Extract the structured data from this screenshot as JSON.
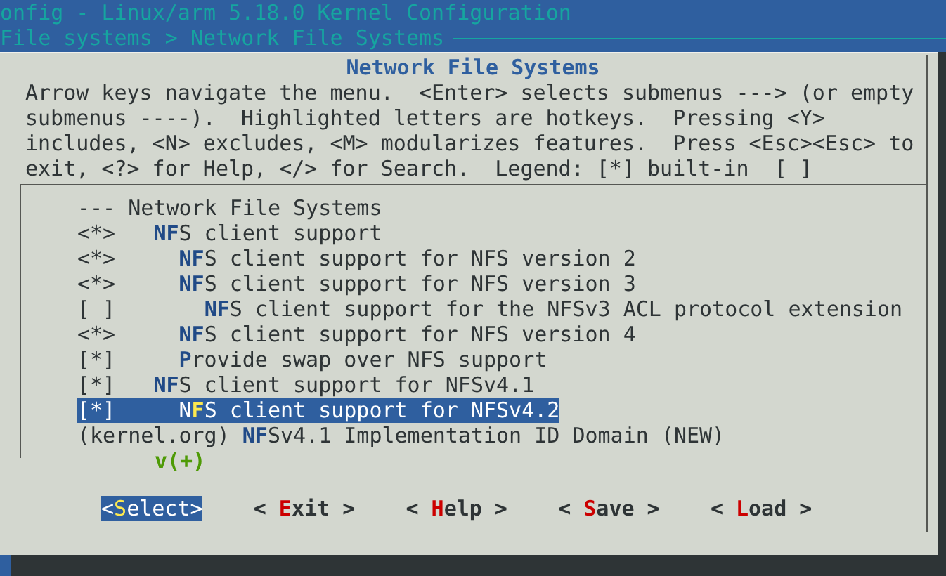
{
  "header": {
    "title": "onfig - Linux/arm 5.18.0 Kernel Configuration",
    "breadcrumb": "File systems > Network File Systems"
  },
  "dialog": {
    "title": "Network File Systems",
    "help": "Arrow keys navigate the menu.  <Enter> selects submenus ---> (or empty\nsubmenus ----).  Highlighted letters are hotkeys.  Pressing <Y>\nincludes, <N> excludes, <M> modularizes features.  Press <Esc><Esc> to\nexit, <?> for Help, </> for Search.  Legend: [*] built-in  [ ]",
    "items": [
      {
        "kind": "heading",
        "prefix": "---",
        "text": "Network File Systems",
        "selected": false
      },
      {
        "kind": "option",
        "prefix": "<*>",
        "text": "**NF**S client support",
        "selected": false,
        "children": [
          {
            "kind": "option",
            "prefix": "<*>",
            "text": "**NF**S client support for NFS version 2",
            "selected": false
          },
          {
            "kind": "option",
            "prefix": "<*>",
            "text": "**NF**S client support for NFS version 3",
            "selected": false,
            "children": [
              {
                "kind": "option",
                "prefix": "[ ]",
                "text": "**NF**S client support for the NFSv3 ACL protocol extension",
                "selected": false
              }
            ]
          },
          {
            "kind": "option",
            "prefix": "<*>",
            "text": "**NF**S client support for NFS version 4",
            "selected": false
          },
          {
            "kind": "option",
            "prefix": "[*]",
            "text": "**P**rovide swap over NFS support",
            "selected": false
          }
        ]
      },
      {
        "kind": "option",
        "prefix": "[*]",
        "text": "**NF**S client support for NFSv4.1",
        "selected": false,
        "children": [
          {
            "kind": "option",
            "prefix": "[*]",
            "text": "N**F**S client support for NFSv4.2",
            "selected": true
          }
        ]
      },
      {
        "kind": "string",
        "prefix": "(kernel.org)",
        "text": "**NF**Sv4.1 Implementation ID Domain (NEW)",
        "selected": false
      }
    ],
    "scroll_indicator": "v(+)",
    "buttons": [
      {
        "label": "<**S**elect>",
        "selected": true
      },
      {
        "label": "< **E**xit >",
        "selected": false
      },
      {
        "label": "< **H**elp >",
        "selected": false
      },
      {
        "label": "< **S**ave >",
        "selected": false
      },
      {
        "label": "< **L**oad >",
        "selected": false
      }
    ]
  }
}
